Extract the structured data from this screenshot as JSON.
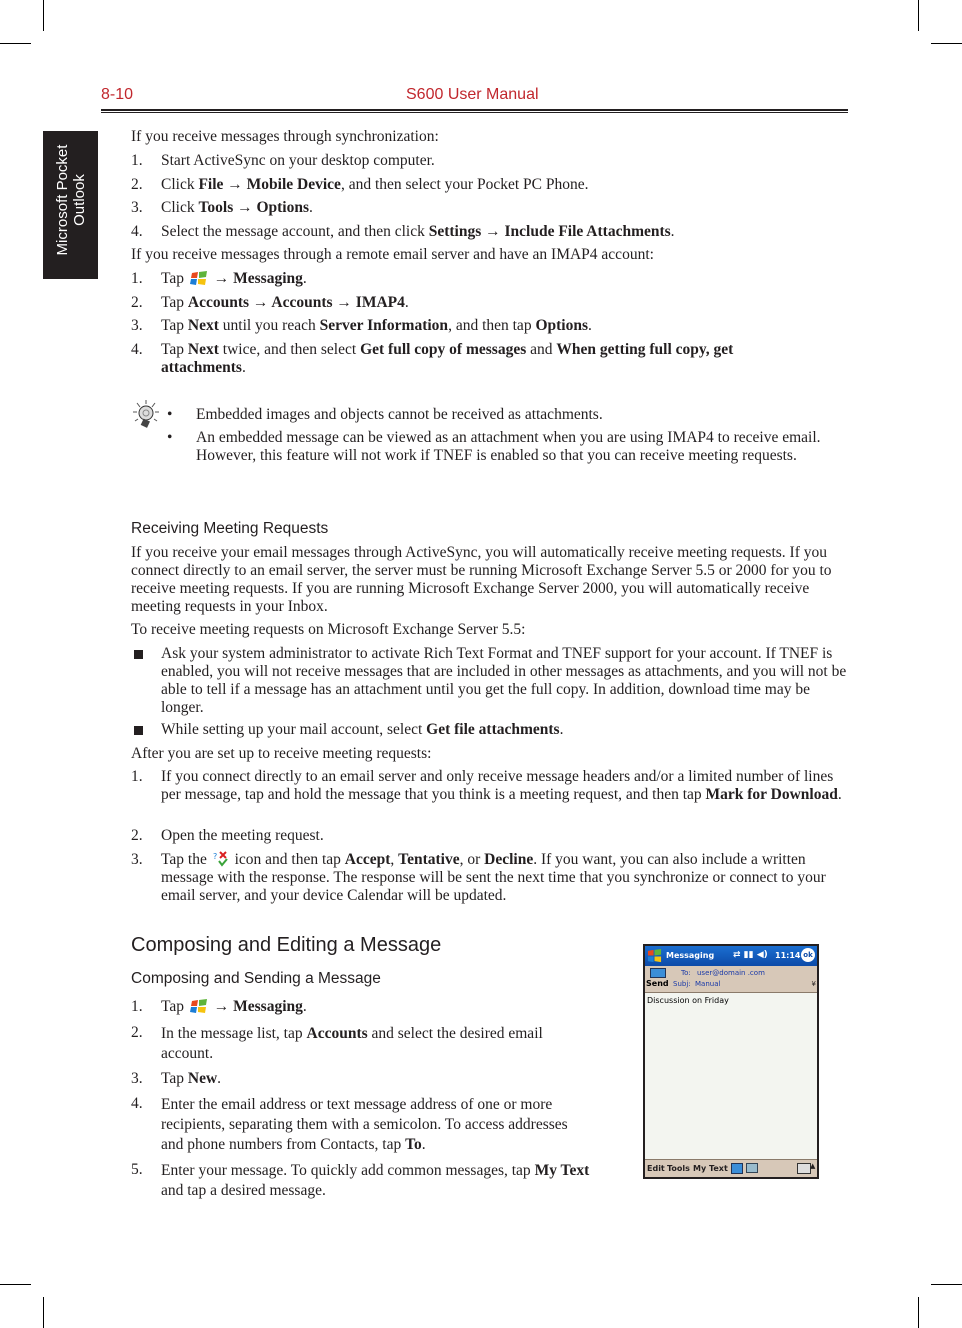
{
  "header": {
    "page_number": "8-10",
    "manual_title": "S600 User Manual"
  },
  "side_tab": {
    "line1": "Microsoft Pocket",
    "line2": "Outlook"
  },
  "section_sync": {
    "intro": "If you receive messages through synchronization:",
    "steps": [
      {
        "num": "1.",
        "parts": [
          {
            "t": "Start ActiveSync on your desktop computer."
          }
        ]
      },
      {
        "num": "2.",
        "parts": [
          {
            "t": "Click "
          },
          {
            "b": "File → Mobile Device"
          },
          {
            "t": ", and then select your Pocket PC Phone."
          }
        ]
      },
      {
        "num": "3.",
        "parts": [
          {
            "t": "Click "
          },
          {
            "b": "Tools → Options"
          },
          {
            "t": "."
          }
        ]
      },
      {
        "num": "4.",
        "parts": [
          {
            "t": "Select the message account, and then click "
          },
          {
            "b": "Settings → Include File Attachments"
          },
          {
            "t": "."
          }
        ]
      }
    ]
  },
  "section_imap": {
    "intro": "If you receive messages through a remote email server and have an IMAP4 account:",
    "steps": [
      {
        "num": "1.",
        "parts": [
          {
            "t": "Tap "
          },
          {
            "icon": "windows-start"
          },
          {
            "t": " → "
          },
          {
            "b": "Messaging"
          },
          {
            "t": "."
          }
        ]
      },
      {
        "num": "2.",
        "parts": [
          {
            "t": "Tap "
          },
          {
            "b": "Accounts → Accounts → IMAP4"
          },
          {
            "t": "."
          }
        ]
      },
      {
        "num": "3.",
        "parts": [
          {
            "t": "Tap "
          },
          {
            "b": "Next"
          },
          {
            "t": " until you reach "
          },
          {
            "b": "Server Information"
          },
          {
            "t": ", and then tap "
          },
          {
            "b": "Options"
          },
          {
            "t": "."
          }
        ]
      },
      {
        "num": "4.",
        "parts": [
          {
            "t": "Tap "
          },
          {
            "b": "Next"
          },
          {
            "t": " twice, and then select "
          },
          {
            "b": "Get full copy of messages"
          },
          {
            "t": " and "
          },
          {
            "b": "When getting full copy, get attachments"
          },
          {
            "t": "."
          }
        ]
      }
    ]
  },
  "tip": {
    "icon": "lightbulb-tip",
    "bullets": [
      "Embedded images and objects cannot be received as attachments.",
      "An embedded message can be viewed as an attachment when you are using IMAP4 to receive email. However, this feature will not work if TNEF is enabled so that you can receive meeting requests."
    ]
  },
  "meeting": {
    "heading": "Receiving Meeting Requests",
    "para1": "If you receive your email messages through ActiveSync, you will automatically receive meeting requests. If you connect directly to an email server, the server must be running Microsoft Exchange Server 5.5 or 2000 for you to receive meeting requests. If you are running Microsoft Exchange Server 2000, you will automatically receive meeting requests in your Inbox.",
    "para2": "To receive meeting requests on Microsoft Exchange Server 5.5:",
    "bullets": [
      {
        "parts": [
          {
            "t": "Ask your system administrator to activate Rich Text Format and TNEF support for your account. If TNEF is enabled, you will not receive messages that are included in other messages as attachments, and you will not be able to tell if a message has an attachment until you get the full copy. In addition, download time may be longer."
          }
        ]
      },
      {
        "parts": [
          {
            "t": "While setting up your mail account, select "
          },
          {
            "b": "Get file attachments"
          },
          {
            "t": "."
          }
        ]
      }
    ],
    "para3": "After you are set up to receive meeting requests:",
    "steps": [
      {
        "num": "1.",
        "parts": [
          {
            "t": "If you connect directly to an email server and only receive message headers and/or a limited number of lines per message, tap and hold the message that you think is a meeting request, and then tap "
          },
          {
            "b": "Mark for Download"
          },
          {
            "t": "."
          }
        ]
      },
      {
        "num": "2.",
        "parts": [
          {
            "t": "Open the meeting request."
          }
        ]
      },
      {
        "num": "3.",
        "parts": [
          {
            "t": "Tap the "
          },
          {
            "icon": "meeting-response"
          },
          {
            "t": " icon and then tap "
          },
          {
            "b": "Accept"
          },
          {
            "t": ", "
          },
          {
            "b": "Tentative"
          },
          {
            "t": ", or "
          },
          {
            "b": "Decline"
          },
          {
            "t": ". If you want, you can also include a written message with the response. The response will be sent the next time that you synchronize or connect to your email server, and your device Calendar will be updated."
          }
        ]
      }
    ]
  },
  "composing": {
    "heading": "Composing and Editing a Message",
    "subheading": "Composing and Sending a Message",
    "steps": [
      {
        "num": "1.",
        "parts": [
          {
            "t": "Tap "
          },
          {
            "icon": "windows-start"
          },
          {
            "t": " → "
          },
          {
            "b": "Messaging"
          },
          {
            "t": "."
          }
        ]
      },
      {
        "num": "2.",
        "parts": [
          {
            "t": "In the message list, tap "
          },
          {
            "b": "Accounts"
          },
          {
            "t": " and select the desired email account."
          }
        ]
      },
      {
        "num": "3.",
        "parts": [
          {
            "t": "Tap "
          },
          {
            "b": "New"
          },
          {
            "t": "."
          }
        ]
      },
      {
        "num": "4.",
        "parts": [
          {
            "t": "Enter the email address or text message address of one or more recipients, separating them with a semicolon. To access addresses and phone numbers from Contacts, tap "
          },
          {
            "b": "To"
          },
          {
            "t": "."
          }
        ]
      },
      {
        "num": "5.",
        "parts": [
          {
            "t": "Enter your message. To quickly add common messages, tap "
          },
          {
            "b": "My Text"
          },
          {
            "t": " and tap a desired message."
          }
        ]
      }
    ]
  },
  "screenshot": {
    "app_title": "Messaging",
    "time": "11:14",
    "ok_label": "ok",
    "send_label": "Send",
    "to_label": "To:",
    "to_value": "user@domain .com",
    "subject_label": "Subj:",
    "subject_value": "Manual",
    "body_text": "Discussion on Friday",
    "menu": [
      "Edit",
      "Tools",
      "My Text"
    ]
  }
}
